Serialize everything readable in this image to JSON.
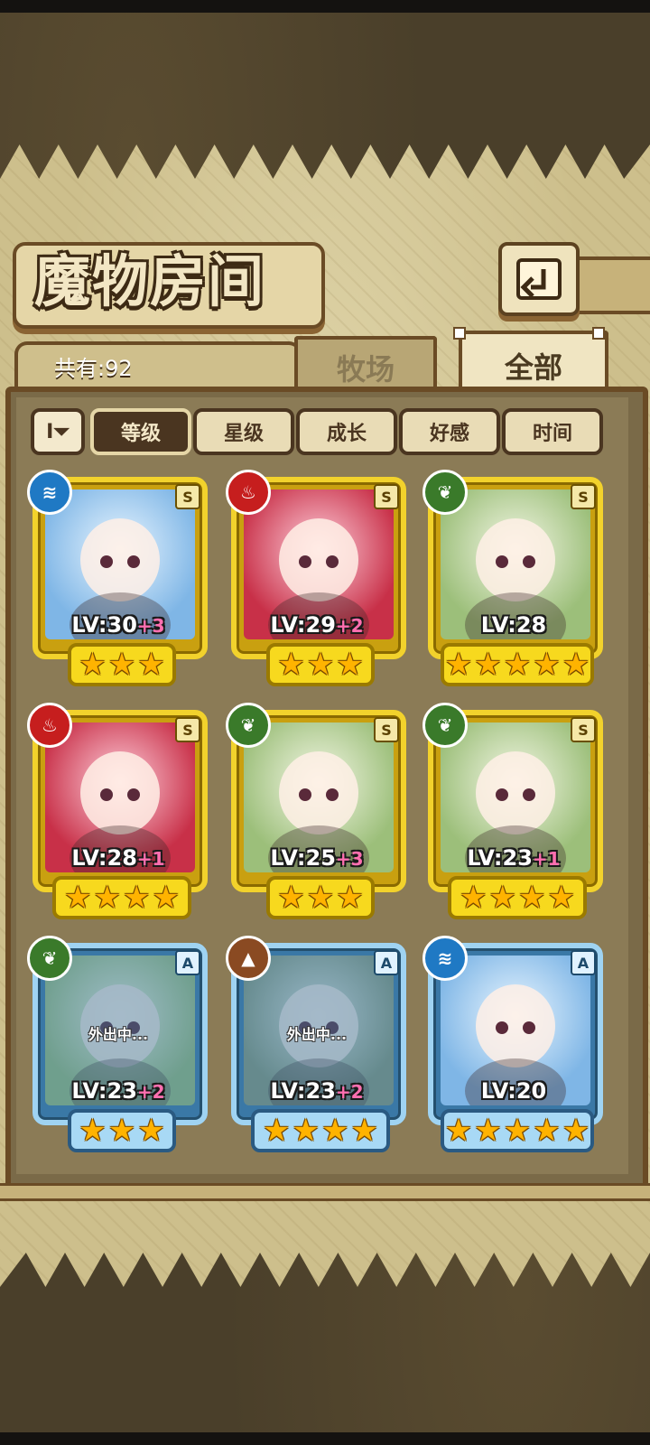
{
  "header": {
    "title": "魔物房间",
    "back_icon": "back-arrow-icon"
  },
  "collection": {
    "count_text": "共有:92"
  },
  "tabs": [
    {
      "label": "牧场",
      "active": false
    },
    {
      "label": "全部",
      "active": true
    }
  ],
  "sort": {
    "toggle_icon": "sort-order-icon",
    "toggle_glyph": "I⏷",
    "buttons": [
      {
        "label": "等级",
        "active": true
      },
      {
        "label": "星级",
        "active": false
      },
      {
        "label": "成长",
        "active": false
      },
      {
        "label": "好感",
        "active": false
      },
      {
        "label": "时间",
        "active": false
      }
    ]
  },
  "monsters": [
    {
      "element": "water",
      "element_glyph": "≋",
      "rank": "S",
      "level": "LV:30",
      "bonus": "+3",
      "stars": 3,
      "frame": "gold",
      "status": ""
    },
    {
      "element": "fire",
      "element_glyph": "♨",
      "rank": "S",
      "level": "LV:29",
      "bonus": "+2",
      "stars": 3,
      "frame": "gold",
      "status": ""
    },
    {
      "element": "wood",
      "element_glyph": "❦",
      "rank": "S",
      "level": "LV:28",
      "bonus": "",
      "stars": 5,
      "frame": "gold",
      "status": ""
    },
    {
      "element": "fire",
      "element_glyph": "♨",
      "rank": "S",
      "level": "LV:28",
      "bonus": "+1",
      "stars": 4,
      "frame": "gold",
      "status": ""
    },
    {
      "element": "wood",
      "element_glyph": "❦",
      "rank": "S",
      "level": "LV:25",
      "bonus": "+3",
      "stars": 3,
      "frame": "gold",
      "status": ""
    },
    {
      "element": "wood",
      "element_glyph": "❦",
      "rank": "S",
      "level": "LV:23",
      "bonus": "+1",
      "stars": 4,
      "frame": "gold",
      "status": ""
    },
    {
      "element": "wood",
      "element_glyph": "❦",
      "rank": "A",
      "level": "LV:23",
      "bonus": "+2",
      "stars": 3,
      "frame": "blue",
      "status": "外出中..."
    },
    {
      "element": "earth",
      "element_glyph": "▲",
      "rank": "A",
      "level": "LV:23",
      "bonus": "+2",
      "stars": 4,
      "frame": "blue",
      "status": "外出中..."
    },
    {
      "element": "water",
      "element_glyph": "≋",
      "rank": "A",
      "level": "LV:20",
      "bonus": "",
      "stars": 5,
      "frame": "blue",
      "status": ""
    }
  ],
  "colors": {
    "gold_frame": "#f2d22c",
    "blue_frame": "#9fd3f2",
    "bonus_pink": "#ff6fb0",
    "wood_element": "#3a7a2a",
    "fire_element": "#c61e1e",
    "water_element": "#1f79c4",
    "earth_element": "#8a4a22"
  }
}
